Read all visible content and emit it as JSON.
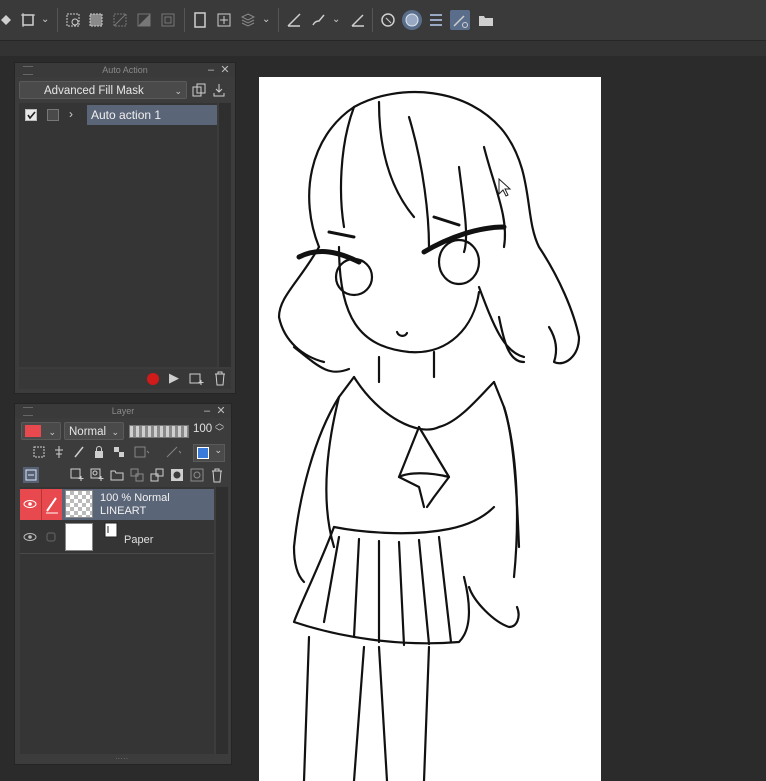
{
  "toolbar": {
    "icons": [
      "fill-icon",
      "transform-icon",
      "select-icon",
      "select-rect-icon",
      "deselect-icon",
      "invert-icon",
      "expand-icon",
      "canvas-icon",
      "crop-icon",
      "layer-stack-icon",
      "ruler-icon",
      "brush-icon",
      "snap-icon",
      "snap-active-icon",
      "sphere-icon",
      "list-icon",
      "pen-settings-icon",
      "folder-open-icon"
    ]
  },
  "auto_action": {
    "title": "Auto Action",
    "set_name": "Advanced Fill Mask",
    "items": [
      {
        "label": "Auto action 1",
        "checked": true
      }
    ]
  },
  "layer": {
    "title": "Layer",
    "blend_mode": "Normal",
    "opacity": "100",
    "color": "#e8494e",
    "layers": [
      {
        "line1": "100 % Normal",
        "line2": "LINEART",
        "selected": true
      },
      {
        "line1": "Paper",
        "line2": "",
        "selected": false
      }
    ]
  },
  "colors": {
    "accent_red": "#e8494e",
    "selection": "#5b6578",
    "record": "#d11a1a"
  }
}
